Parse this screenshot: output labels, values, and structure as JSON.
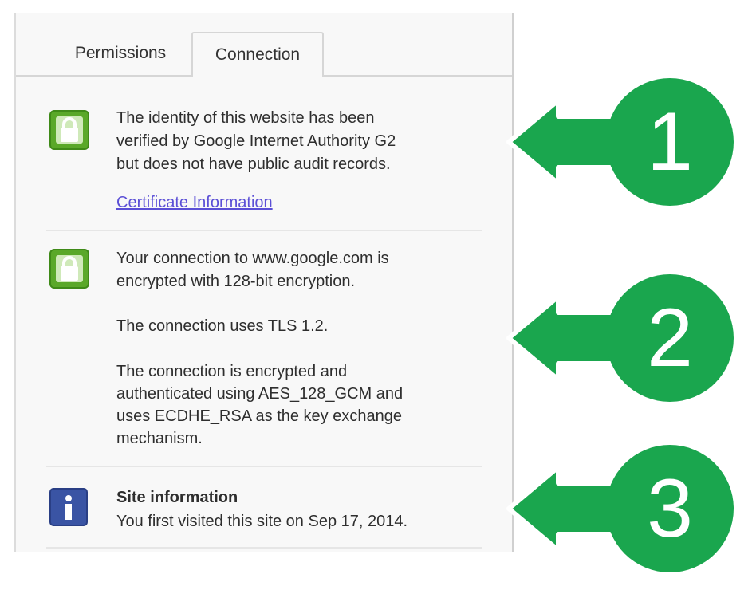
{
  "tabs": [
    {
      "label": "Permissions",
      "active": false
    },
    {
      "label": "Connection",
      "active": true
    }
  ],
  "identity": {
    "icon": "lock-icon",
    "lines": [
      "The identity of this website has been",
      "verified by Google Internet Authority G2",
      "but does not have public audit records."
    ],
    "link": "Certificate Information"
  },
  "encryption": {
    "icon": "lock-icon",
    "lines": [
      "Your connection to www.google.com is",
      "encrypted with 128-bit encryption."
    ],
    "tls": "The connection uses TLS 1.2.",
    "detail_lines": [
      "The connection is encrypted and",
      "authenticated using AES_128_GCM and",
      "uses ECDHE_RSA as the key exchange",
      "mechanism."
    ]
  },
  "site_info": {
    "icon": "info-icon",
    "title": "Site information",
    "text": "You first visited this site on Sep 17, 2014."
  },
  "markers": [
    {
      "number": "1"
    },
    {
      "number": "2"
    },
    {
      "number": "3"
    }
  ],
  "colors": {
    "marker_green": "#1aa64e",
    "lock_green": "#5aa829",
    "info_blue": "#3a54a4",
    "link": "#5b4fd6"
  }
}
